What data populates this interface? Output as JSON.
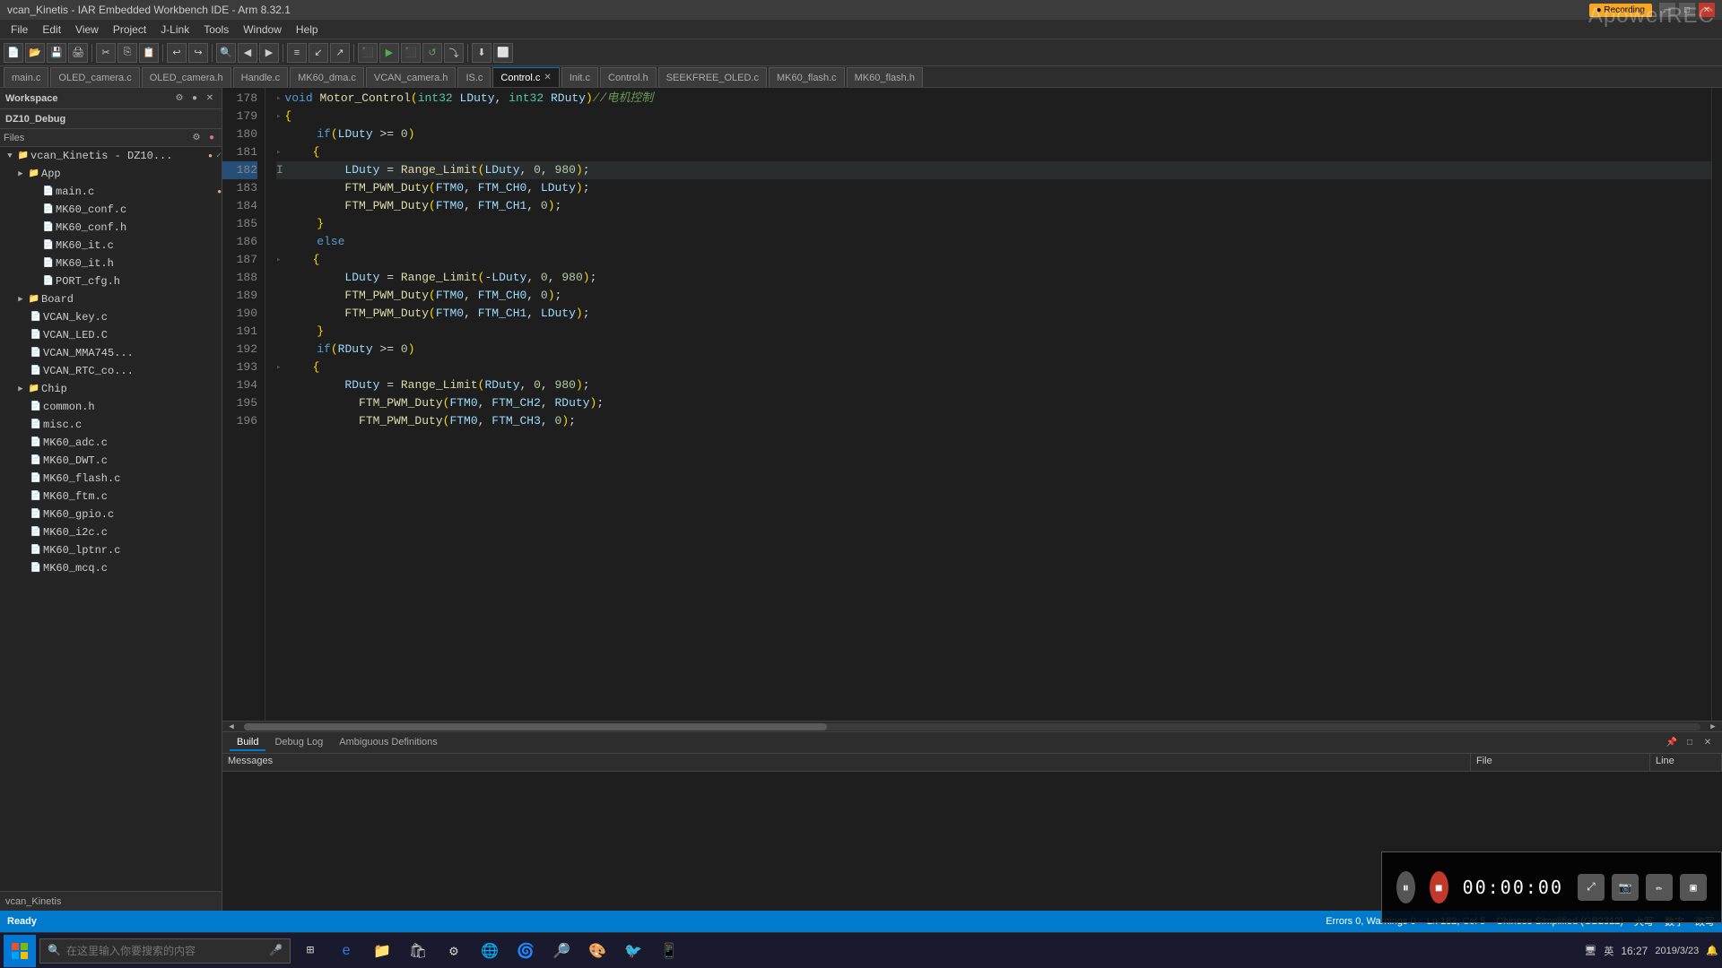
{
  "window": {
    "title": "vcan_Kinetis - IAR Embedded Workbench IDE - Arm 8.32.1",
    "recording_indicator": "●"
  },
  "apowerrec": "ApowerREC",
  "menu": {
    "items": [
      "File",
      "Edit",
      "View",
      "Project",
      "J-Link",
      "Tools",
      "Window",
      "Help"
    ]
  },
  "tabs": [
    {
      "label": "main.c",
      "active": false,
      "closable": false
    },
    {
      "label": "OLED_camera.c",
      "active": false,
      "closable": false
    },
    {
      "label": "OLED_camera.h",
      "active": false,
      "closable": false
    },
    {
      "label": "Handle.c",
      "active": false,
      "closable": false
    },
    {
      "label": "MK60_dma.c",
      "active": false,
      "closable": false
    },
    {
      "label": "VCAN_camera.h",
      "active": false,
      "closable": false
    },
    {
      "label": "IS.c",
      "active": false,
      "closable": false
    },
    {
      "label": "Control.c",
      "active": true,
      "closable": true
    },
    {
      "label": "Init.c",
      "active": false,
      "closable": false
    },
    {
      "label": "Control.h",
      "active": false,
      "closable": false
    },
    {
      "label": "SEEKFREE_OLED.c",
      "active": false,
      "closable": false
    },
    {
      "label": "MK60_flash.c",
      "active": false,
      "closable": false
    },
    {
      "label": "MK60_flash.h",
      "active": false,
      "closable": false
    }
  ],
  "workspace": {
    "label": "Workspace",
    "name": "DZ10_Debug"
  },
  "file_tree": {
    "root": "vcan_Kinetis - DZ10...",
    "items": [
      {
        "level": 0,
        "label": "vcan_Kinetis - DZ10...",
        "type": "project",
        "arrow": "▼",
        "modified": true,
        "checked": true
      },
      {
        "level": 1,
        "label": "App",
        "type": "folder",
        "arrow": "▶"
      },
      {
        "level": 2,
        "label": "main.c",
        "type": "file",
        "arrow": "",
        "modified": true
      },
      {
        "level": 2,
        "label": "MK60_conf.c",
        "type": "file",
        "arrow": ""
      },
      {
        "level": 2,
        "label": "MK60_conf.h",
        "type": "file",
        "arrow": ""
      },
      {
        "level": 2,
        "label": "MK60_it.c",
        "type": "file",
        "arrow": ""
      },
      {
        "level": 2,
        "label": "MK60_it.h",
        "type": "file",
        "arrow": ""
      },
      {
        "level": 2,
        "label": "PORT_cfg.h",
        "type": "file",
        "arrow": ""
      },
      {
        "level": 1,
        "label": "Board",
        "type": "folder",
        "arrow": "▶"
      },
      {
        "level": 2,
        "label": "VCAN_key.c",
        "type": "file",
        "arrow": ""
      },
      {
        "level": 2,
        "label": "VCAN_LED.C",
        "type": "file",
        "arrow": ""
      },
      {
        "level": 2,
        "label": "VCAN_MMA745...",
        "type": "file",
        "arrow": ""
      },
      {
        "level": 2,
        "label": "VCAN_RTC_co...",
        "type": "file",
        "arrow": ""
      },
      {
        "level": 1,
        "label": "Chip",
        "type": "folder",
        "arrow": "▶"
      },
      {
        "level": 2,
        "label": "common.h",
        "type": "file",
        "arrow": ""
      },
      {
        "level": 2,
        "label": "misc.c",
        "type": "file",
        "arrow": ""
      },
      {
        "level": 2,
        "label": "MK60_adc.c",
        "type": "file",
        "arrow": ""
      },
      {
        "level": 2,
        "label": "MK60_DWT.c",
        "type": "file",
        "arrow": ""
      },
      {
        "level": 2,
        "label": "MK60_flash.c",
        "type": "file",
        "arrow": ""
      },
      {
        "level": 2,
        "label": "MK60_ftm.c",
        "type": "file",
        "arrow": ""
      },
      {
        "level": 2,
        "label": "MK60_gpio.c",
        "type": "file",
        "arrow": ""
      },
      {
        "level": 2,
        "label": "MK60_i2c.c",
        "type": "file",
        "arrow": ""
      },
      {
        "level": 2,
        "label": "MK60_lptnr.c",
        "type": "file",
        "arrow": ""
      },
      {
        "level": 2,
        "label": "MK60_mcq.c",
        "type": "file",
        "arrow": ""
      }
    ]
  },
  "sidebar_footer": "vcan_Kinetis",
  "code": {
    "lines": [
      {
        "num": 178,
        "content": "void Motor_Control(int32 LDuty, int32 RDuty)//电机控制",
        "fold": true
      },
      {
        "num": 179,
        "content": "{",
        "fold": true
      },
      {
        "num": 180,
        "content": "    if(LDuty >= 0)"
      },
      {
        "num": 181,
        "content": "    {",
        "fold": true
      },
      {
        "num": 182,
        "content": "        LDuty = Range_Limit(LDuty, 0, 980);"
      },
      {
        "num": 183,
        "content": "        FTM_PWM_Duty(FTM0, FTM_CH0, LDuty);"
      },
      {
        "num": 184,
        "content": "        FTM_PWM_Duty(FTM0, FTM_CH1, 0);"
      },
      {
        "num": 185,
        "content": "    }"
      },
      {
        "num": 186,
        "content": "    else"
      },
      {
        "num": 187,
        "content": "    {",
        "fold": true
      },
      {
        "num": 188,
        "content": "        LDuty = Range_Limit(-LDuty, 0, 980);"
      },
      {
        "num": 189,
        "content": "        FTM_PWM_Duty(FTM0, FTM_CH0, 0);"
      },
      {
        "num": 190,
        "content": "        FTM_PWM_Duty(FTM0, FTM_CH1, LDuty);"
      },
      {
        "num": 191,
        "content": "    }"
      },
      {
        "num": 192,
        "content": "    if(RDuty >= 0)"
      },
      {
        "num": 193,
        "content": "    {",
        "fold": true
      },
      {
        "num": 194,
        "content": "        RDuty = Range_Limit(RDuty, 0, 980);"
      },
      {
        "num": 195,
        "content": "        FTM_PWM_Duty(FTM0, FTM_CH2, RDuty);"
      },
      {
        "num": 196,
        "content": "        FTM_PWM_Duty(FTM0, FTM_CH3, 0);"
      }
    ]
  },
  "build_panel": {
    "tabs": [
      "Build",
      "Debug Log",
      "Ambiguous Definitions"
    ],
    "active_tab": "Build",
    "table_headers": [
      "Messages",
      "File",
      "Line"
    ]
  },
  "status_bar": {
    "ready": "Ready",
    "errors": "Errors 0, Warnings 0",
    "position": "Ln 182, Col 5",
    "encoding": "Chinese Simplified (GB2312)",
    "font": "大写",
    "mode": "数字",
    "edit_mode": "改写"
  },
  "taskbar": {
    "search_placeholder": "在这里输入你要搜索的内容",
    "clock": "16:27",
    "date": "2019/3/23"
  },
  "recording": {
    "timer": "00:00:00",
    "pause_icon": "⏸",
    "stop_icon": "■"
  }
}
